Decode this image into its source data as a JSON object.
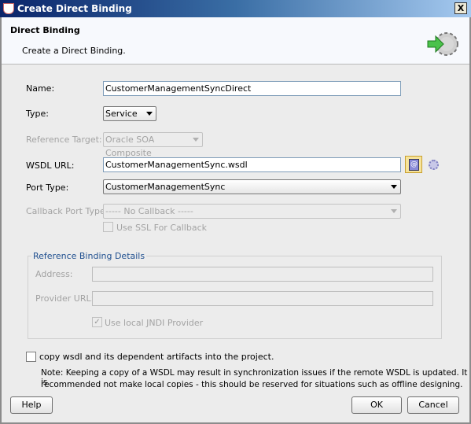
{
  "window": {
    "title": "Create Direct Binding",
    "close_label": "X"
  },
  "header": {
    "title": "Direct Binding",
    "subtitle": "Create a Direct Binding.",
    "icon": "gear-arrow-icon"
  },
  "form": {
    "name_label": "Name:",
    "name_value": "CustomerManagementSyncDirect",
    "type_label": "Type:",
    "type_value": "Service",
    "reference_target_label": "Reference Target:",
    "reference_target_value": "Oracle SOA Composite",
    "wsdl_label": "WSDL URL:",
    "wsdl_value": "CustomerManagementSync.wsdl",
    "port_type_label": "Port Type:",
    "port_type_value": "CustomerManagementSync",
    "callback_label": "Callback Port Type:",
    "callback_value": "----- No Callback -----",
    "ssl_label": "Use SSL For Callback",
    "ssl_checked": false
  },
  "reference_binding": {
    "legend": "Reference Binding Details",
    "address_label": "Address:",
    "address_value": "",
    "provider_label": "Provider URL:",
    "provider_value": "",
    "jndi_label": "Use local JNDI Provider",
    "jndi_checked": true
  },
  "copy": {
    "label": "copy wsdl and its dependent artifacts into the project.",
    "checked": false,
    "note_line1": "Note: Keeping a copy of a WSDL may result in synchronization issues if the remote WSDL is updated. It is",
    "note_line2": "recommended not make local copies - this should be reserved for situations such as offline designing."
  },
  "buttons": {
    "help": "Help",
    "ok": "OK",
    "cancel": "Cancel"
  }
}
